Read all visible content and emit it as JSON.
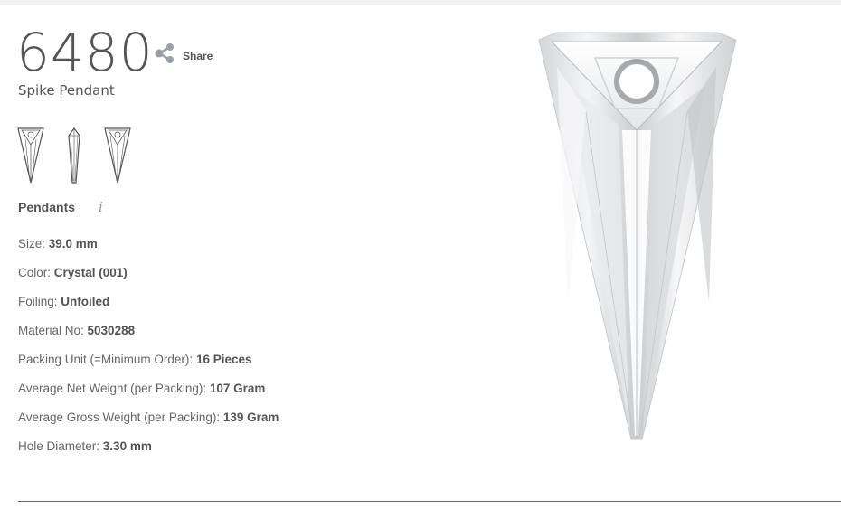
{
  "product": {
    "number": "6480",
    "name": "Spike Pendant",
    "category": "Pendants",
    "share_label": "Share"
  },
  "specs": [
    {
      "label": "Size: ",
      "value": "39.0 mm"
    },
    {
      "label": "Color: ",
      "value": "Crystal (001)"
    },
    {
      "label": "Foiling: ",
      "value": "Unfoiled"
    },
    {
      "label": "Material No: ",
      "value": "5030288"
    },
    {
      "label": "Packing Unit (=Minimum Order): ",
      "value": "16 Pieces"
    },
    {
      "label": "Average Net Weight (per Packing): ",
      "value": "107 Gram"
    },
    {
      "label": "Average Gross Weight (per Packing): ",
      "value": "139 Gram"
    },
    {
      "label": "Hole Diameter: ",
      "value": "3.30 mm"
    }
  ],
  "icons": {
    "share": "share-icon",
    "info": "i"
  },
  "colors": {
    "text": "#555555",
    "muted": "#999999",
    "divider": "#666666"
  }
}
